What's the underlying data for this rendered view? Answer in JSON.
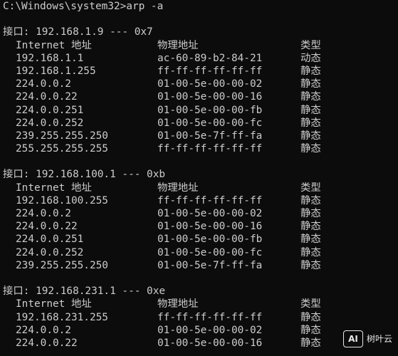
{
  "prompt": "C:\\Windows\\system32>arp -a",
  "interfaces": [
    {
      "header": "接口: 192.168.1.9 --- 0x7",
      "columns": [
        "Internet 地址",
        "物理地址",
        "类型"
      ],
      "rows": [
        [
          "192.168.1.1",
          "ac-60-89-b2-84-21",
          "动态"
        ],
        [
          "192.168.1.255",
          "ff-ff-ff-ff-ff-ff",
          "静态"
        ],
        [
          "224.0.0.2",
          "01-00-5e-00-00-02",
          "静态"
        ],
        [
          "224.0.0.22",
          "01-00-5e-00-00-16",
          "静态"
        ],
        [
          "224.0.0.251",
          "01-00-5e-00-00-fb",
          "静态"
        ],
        [
          "224.0.0.252",
          "01-00-5e-00-00-fc",
          "静态"
        ],
        [
          "239.255.255.250",
          "01-00-5e-7f-ff-fa",
          "静态"
        ],
        [
          "255.255.255.255",
          "ff-ff-ff-ff-ff-ff",
          "静态"
        ]
      ]
    },
    {
      "header": "接口: 192.168.100.1 --- 0xb",
      "columns": [
        "Internet 地址",
        "物理地址",
        "类型"
      ],
      "rows": [
        [
          "192.168.100.255",
          "ff-ff-ff-ff-ff-ff",
          "静态"
        ],
        [
          "224.0.0.2",
          "01-00-5e-00-00-02",
          "静态"
        ],
        [
          "224.0.0.22",
          "01-00-5e-00-00-16",
          "静态"
        ],
        [
          "224.0.0.251",
          "01-00-5e-00-00-fb",
          "静态"
        ],
        [
          "224.0.0.252",
          "01-00-5e-00-00-fc",
          "静态"
        ],
        [
          "239.255.255.250",
          "01-00-5e-7f-ff-fa",
          "静态"
        ]
      ]
    },
    {
      "header": "接口: 192.168.231.1 --- 0xe",
      "columns": [
        "Internet 地址",
        "物理地址",
        "类型"
      ],
      "rows": [
        [
          "192.168.231.255",
          "ff-ff-ff-ff-ff-ff",
          "静态"
        ],
        [
          "224.0.0.2",
          "01-00-5e-00-00-02",
          "静态"
        ],
        [
          "224.0.0.22",
          "01-00-5e-00-00-16",
          "静态"
        ]
      ]
    }
  ],
  "watermark": {
    "logo": "AI",
    "text": "树叶云"
  },
  "colors": {
    "background": "#0c0c0c",
    "text": "#cccccc"
  }
}
